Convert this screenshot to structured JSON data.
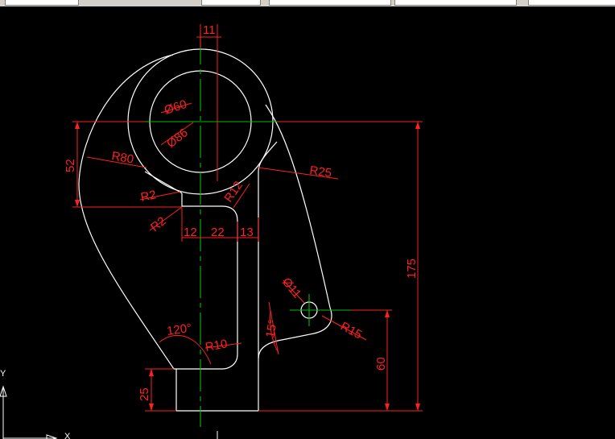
{
  "colors": {
    "background": "#000000",
    "outline": "#ffffff",
    "centerline": "#00c000",
    "dimension": "#ff2020",
    "toolbar": "#d4d0c8"
  },
  "dimensions": {
    "d11_top": "11",
    "phi60": "Ø60",
    "phi86": "Ø86",
    "r80": "R80",
    "h52": "52",
    "r2_upper": "R2",
    "r2_lower": "R2",
    "r12": "R12",
    "r25": "R25",
    "w12": "12",
    "w22": "22",
    "w13": "13",
    "h175": "175",
    "phi11": "Ø11",
    "a15": "15°",
    "r15": "R15",
    "a120": "120°",
    "r10": "R10",
    "h60": "60",
    "h25": "25"
  },
  "ucs": {
    "y_label": "Y",
    "x_label": "X"
  }
}
